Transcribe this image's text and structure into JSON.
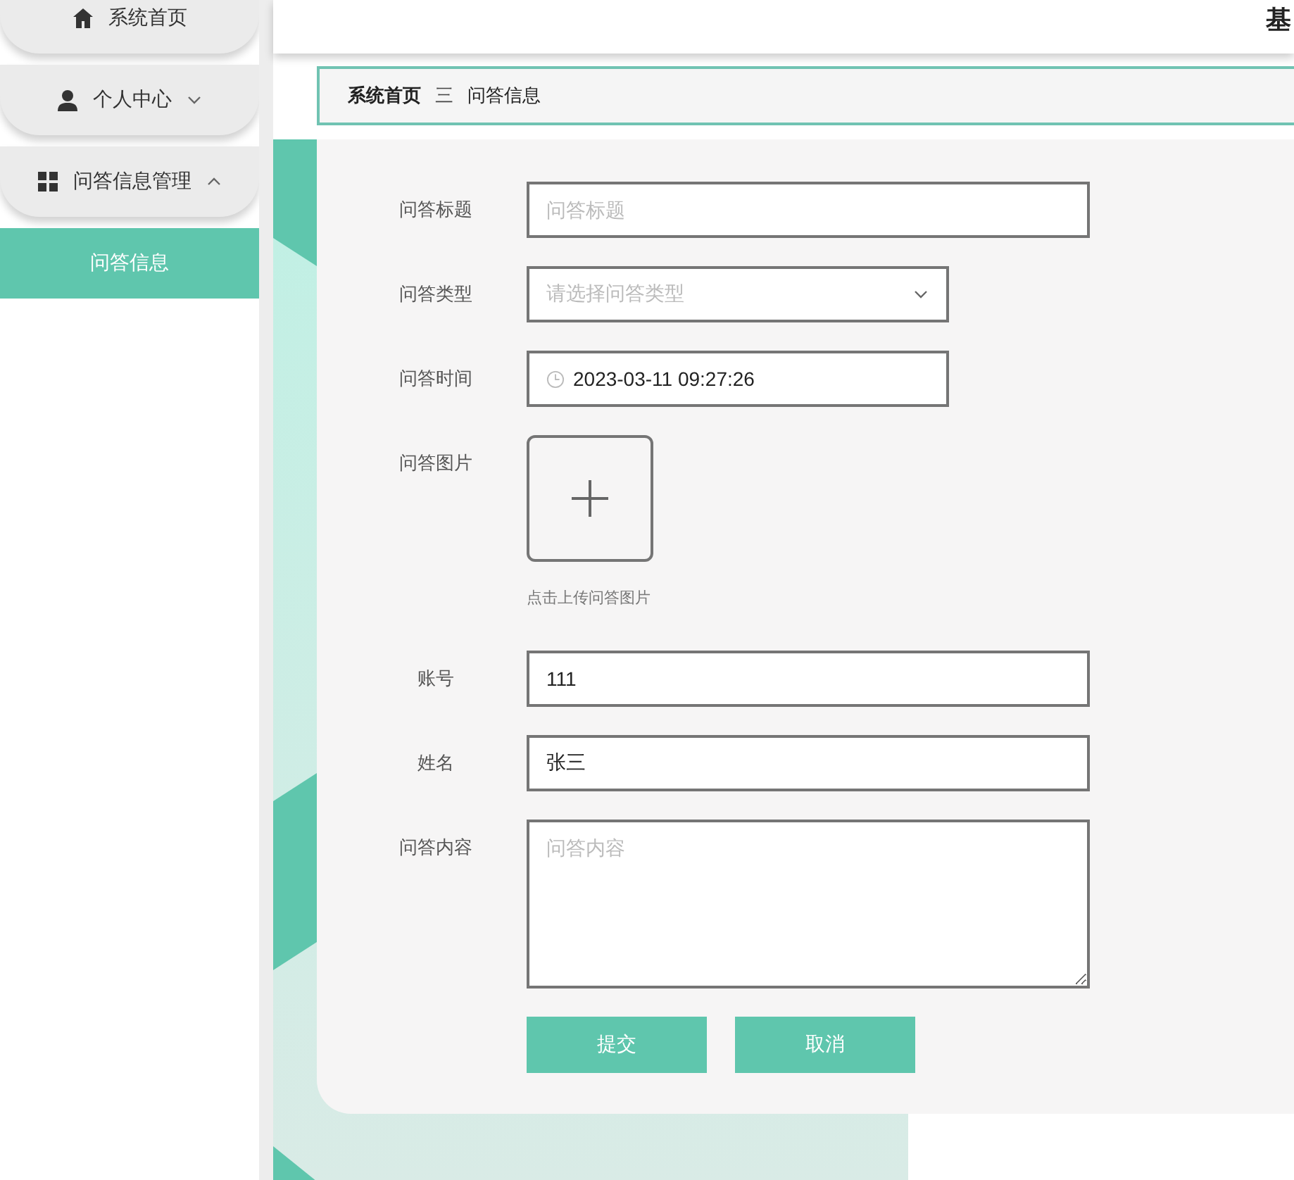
{
  "sidebar": {
    "items": [
      {
        "label": "系统首页",
        "kind": "link"
      },
      {
        "label": "个人中心",
        "kind": "menu",
        "expanded": false
      },
      {
        "label": "问答信息管理",
        "kind": "menu",
        "expanded": true,
        "children": [
          {
            "label": "问答信息",
            "selected": true
          }
        ]
      }
    ]
  },
  "header": {
    "title": "基"
  },
  "breadcrumb": {
    "items": [
      "系统首页",
      "问答信息"
    ],
    "separator": "三"
  },
  "form": {
    "fields": [
      {
        "label": "问答标题",
        "kind": "text",
        "placeholder": "问答标题"
      },
      {
        "label": "问答类型",
        "kind": "select",
        "placeholder": "请选择问答类型"
      },
      {
        "label": "问答时间",
        "kind": "datetime",
        "value": "2023-03-11 09:27:26"
      },
      {
        "label": "问答图片",
        "kind": "upload",
        "hint": "点击上传问答图片"
      },
      {
        "label": "账号",
        "kind": "text",
        "value": "111"
      },
      {
        "label": "姓名",
        "kind": "text",
        "value": "张三"
      },
      {
        "label": "问答内容",
        "kind": "textarea",
        "placeholder": "问答内容"
      }
    ],
    "buttons": [
      "提交",
      "取消"
    ]
  }
}
